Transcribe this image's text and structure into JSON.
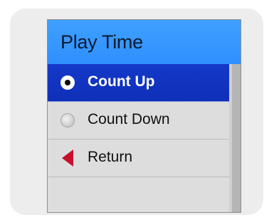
{
  "menu": {
    "title": "Play Time",
    "items": [
      {
        "label": "Count Up",
        "state": "selected",
        "icon": "radio-on-icon"
      },
      {
        "label": "Count Down",
        "state": "unselected",
        "icon": "radio-off-icon"
      },
      {
        "label": "Return",
        "state": "normal",
        "icon": "back-arrow-icon"
      }
    ]
  },
  "colors": {
    "title_bar": "#2f8fff",
    "selected_row": "#1439c9",
    "return_arrow": "#c8102e",
    "row_background": "#dddddd"
  }
}
